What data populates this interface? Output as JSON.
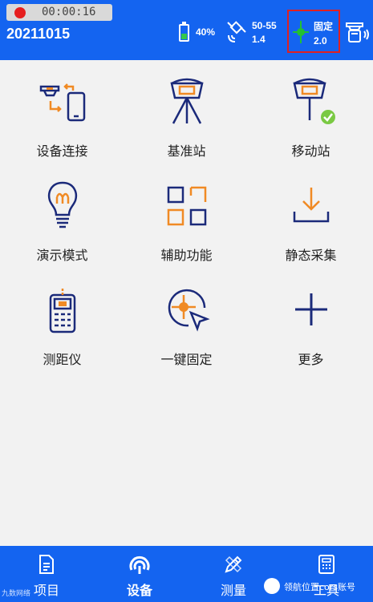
{
  "status_bar": {
    "recording_time": "00:00:16",
    "project_code": "20211015",
    "battery_percent": "40%",
    "battery_level": 0.4,
    "satellites": "50-55",
    "pdop": "1.4",
    "fix_status": "固定",
    "fix_age": "2.0"
  },
  "grid": {
    "items": [
      {
        "label": "设备连接",
        "icon": "device-connect-icon"
      },
      {
        "label": "基准站",
        "icon": "base-station-icon"
      },
      {
        "label": "移动站",
        "icon": "rover-station-icon"
      },
      {
        "label": "演示模式",
        "icon": "lightbulb-icon"
      },
      {
        "label": "辅助功能",
        "icon": "grid-apps-icon"
      },
      {
        "label": "静态采集",
        "icon": "download-icon"
      },
      {
        "label": "测距仪",
        "icon": "rangefinder-icon"
      },
      {
        "label": "一键固定",
        "icon": "target-cursor-icon"
      },
      {
        "label": "更多",
        "icon": "plus-icon"
      }
    ]
  },
  "bottom_nav": {
    "items": [
      {
        "label": "项目",
        "icon": "document-icon"
      },
      {
        "label": "设备",
        "icon": "antenna-icon"
      },
      {
        "label": "测量",
        "icon": "pen-ruler-icon"
      },
      {
        "label": "工具",
        "icon": "calculator-icon"
      }
    ],
    "active_index": 1
  },
  "watermarks": {
    "left": "九数网络",
    "right": "领航位置cors账号"
  },
  "colors": {
    "primary_blue": "#1464f0",
    "icon_navy": "#1b2a7a",
    "icon_orange": "#f08a24",
    "fix_green": "#22c033",
    "highlight_red": "#e02020"
  }
}
